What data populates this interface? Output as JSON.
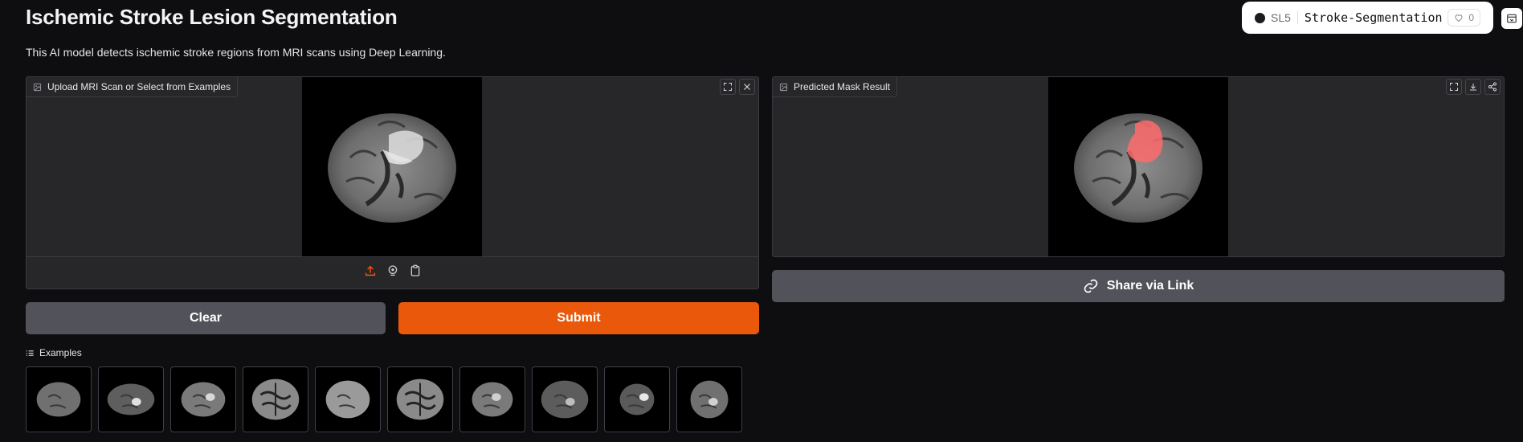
{
  "header": {
    "title": "Ischemic Stroke Lesion Segmentation",
    "subtitle": "This AI model detects ischemic stroke regions from MRI scans using Deep Learning."
  },
  "space": {
    "owner": "SL5",
    "name": "Stroke-Segmentation",
    "likes": "0"
  },
  "input_panel": {
    "label": "Upload MRI Scan or Select from Examples",
    "tools": [
      "fullscreen-icon",
      "close-icon"
    ],
    "sources": [
      "upload-icon",
      "webcam-icon",
      "clipboard-icon"
    ]
  },
  "output_panel": {
    "label": "Predicted Mask Result",
    "tools": [
      "fullscreen-icon",
      "download-icon",
      "share-icon"
    ]
  },
  "buttons": {
    "clear": "Clear",
    "submit": "Submit",
    "share": "Share via Link"
  },
  "examples": {
    "label": "Examples",
    "count": 10
  },
  "colors": {
    "accent": "#ea580c",
    "background": "#0e0e11",
    "panel": "#27272a",
    "secondary_button": "#52525b",
    "mask": "#ff6b6b"
  }
}
